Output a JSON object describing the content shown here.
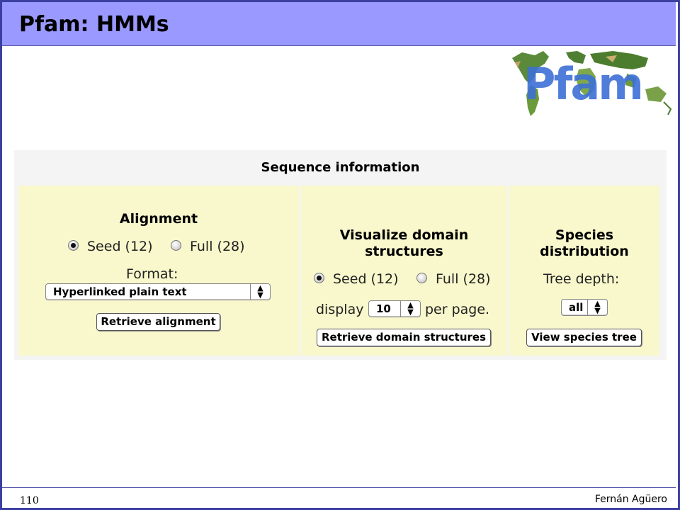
{
  "slide": {
    "title": "Pfam: HMMs",
    "page_number": "110",
    "author": "Fernán Agüero",
    "logo_text": "Pfam"
  },
  "panel": {
    "title": "Sequence information",
    "alignment": {
      "heading": "Alignment",
      "seed_label": "Seed (12)",
      "full_label": "Full (28)",
      "selected": "seed",
      "format_label": "Format:",
      "format_value": "Hyperlinked plain text",
      "button": "Retrieve alignment"
    },
    "domains": {
      "heading_line1": "Visualize domain",
      "heading_line2": "structures",
      "seed_label": "Seed (12)",
      "full_label": "Full (28)",
      "selected": "seed",
      "display_label": "display",
      "display_value": "10",
      "per_page_label": "per page.",
      "button": "Retrieve domain structures"
    },
    "species": {
      "heading_line1": "Species",
      "heading_line2": "distribution",
      "depth_label": "Tree depth:",
      "depth_value": "all",
      "button": "View species tree"
    }
  },
  "colors": {
    "title_bar": "#9999ff",
    "frame": "#3b3fa0",
    "cell_bg": "#f8f8cc",
    "panel_bg": "#f4f4f4",
    "logo_text": "#3d6fd6"
  }
}
